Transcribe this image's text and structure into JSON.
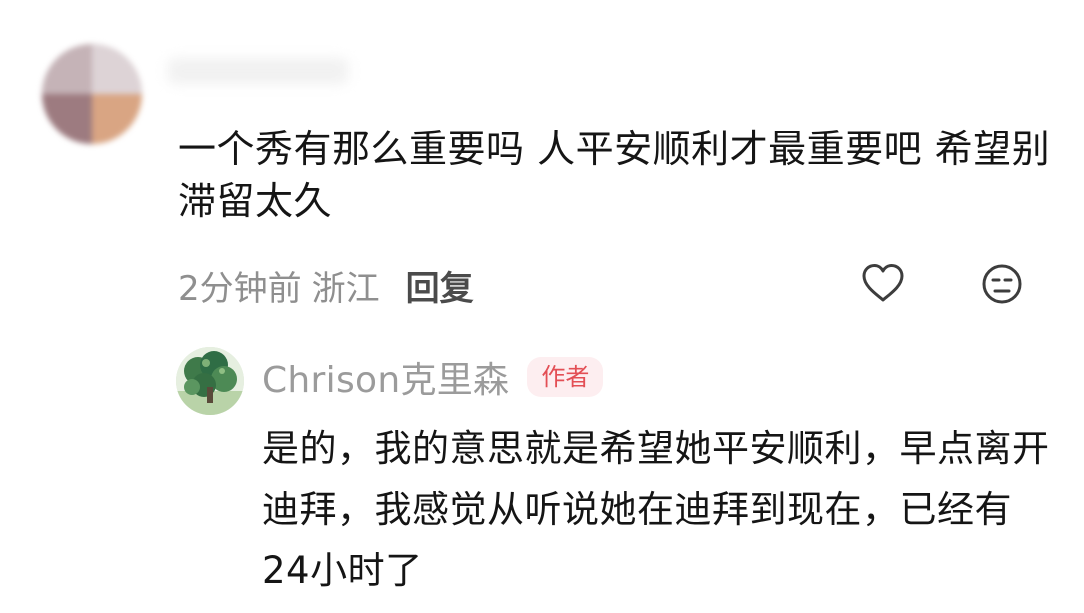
{
  "comment": {
    "avatar_icon": "blurred-avatar",
    "username": "",
    "text": "一个秀有那么重要吗 人平安顺利才最重要吧 希望别滞留太久",
    "time": "2分钟前",
    "location": "浙江",
    "reply_label": "回复",
    "like_icon": "heart-outline-icon",
    "dislike_icon": "neutral-face-icon"
  },
  "reply": {
    "avatar_icon": "tree-painting-avatar",
    "username": "Chrison克里森",
    "badge": "作者",
    "text": "是的，我的意思就是希望她平安顺利，早点离开迪拜，我感觉从听说她在迪拜到现在，已经有24小时了"
  },
  "colors": {
    "text_primary": "#151515",
    "text_secondary": "#8f8f8f",
    "badge_text": "#e34f55",
    "badge_bg": "#fdeef0"
  }
}
